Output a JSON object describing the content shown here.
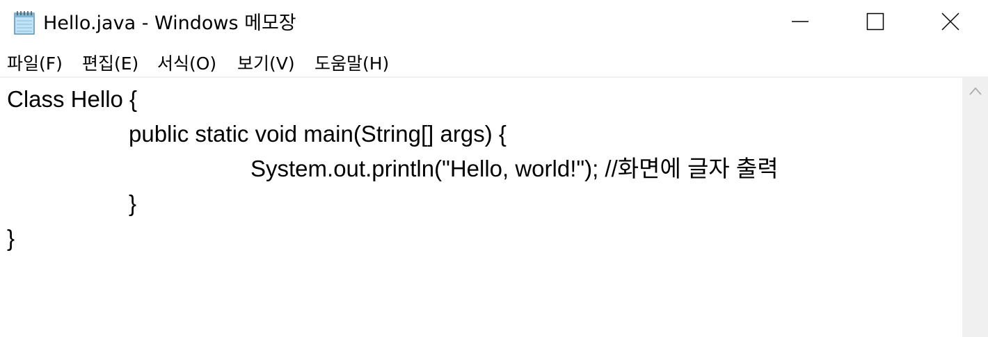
{
  "window": {
    "title": "Hello.java - Windows 메모장",
    "app_icon": "notepad-icon",
    "controls": {
      "minimize_icon": "minimize-icon",
      "maximize_icon": "maximize-icon",
      "close_icon": "close-icon"
    }
  },
  "menu": {
    "items": [
      {
        "label": "파일(F)"
      },
      {
        "label": "편집(E)"
      },
      {
        "label": "서식(O)"
      },
      {
        "label": "보기(V)"
      },
      {
        "label": "도움말(H)"
      }
    ]
  },
  "editor": {
    "lines": [
      "Class Hello {",
      "public static void main(String[] args) {",
      "System.out.println(\"Hello, world!\"); //화면에 글자 출력",
      "}",
      "}"
    ]
  },
  "scrollbar": {
    "up_icon": "chevron-up-icon"
  },
  "colors": {
    "background": "#ffffff",
    "scrollbar_track": "#f0f0f0",
    "text": "#000000"
  }
}
